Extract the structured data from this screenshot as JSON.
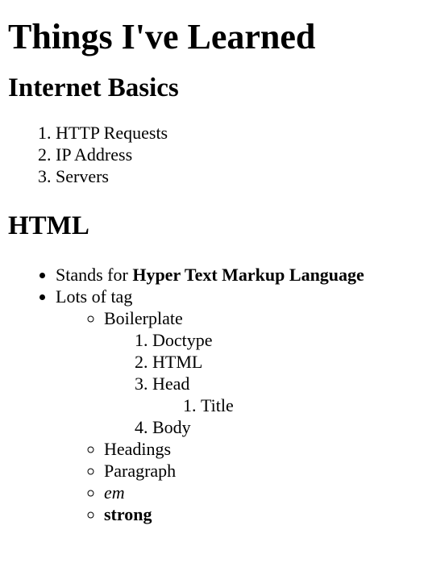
{
  "title": "Things I've Learned",
  "sections": {
    "internet": {
      "heading": "Internet Basics",
      "items": [
        "HTTP Requests",
        "IP Address",
        "Servers"
      ]
    },
    "html": {
      "heading": "HTML",
      "item1_prefix": "Stands for ",
      "item1_bold": "Hyper Text Markup Language",
      "item2": "Lots of tag",
      "tags": {
        "boilerplate": "Boilerplate",
        "boilerplate_items": [
          "Doctype",
          "HTML",
          "Head",
          "Body"
        ],
        "head_items": [
          "Title"
        ],
        "headings": "Headings",
        "paragraph": "Paragraph",
        "em": "em",
        "strong": "strong"
      }
    }
  }
}
